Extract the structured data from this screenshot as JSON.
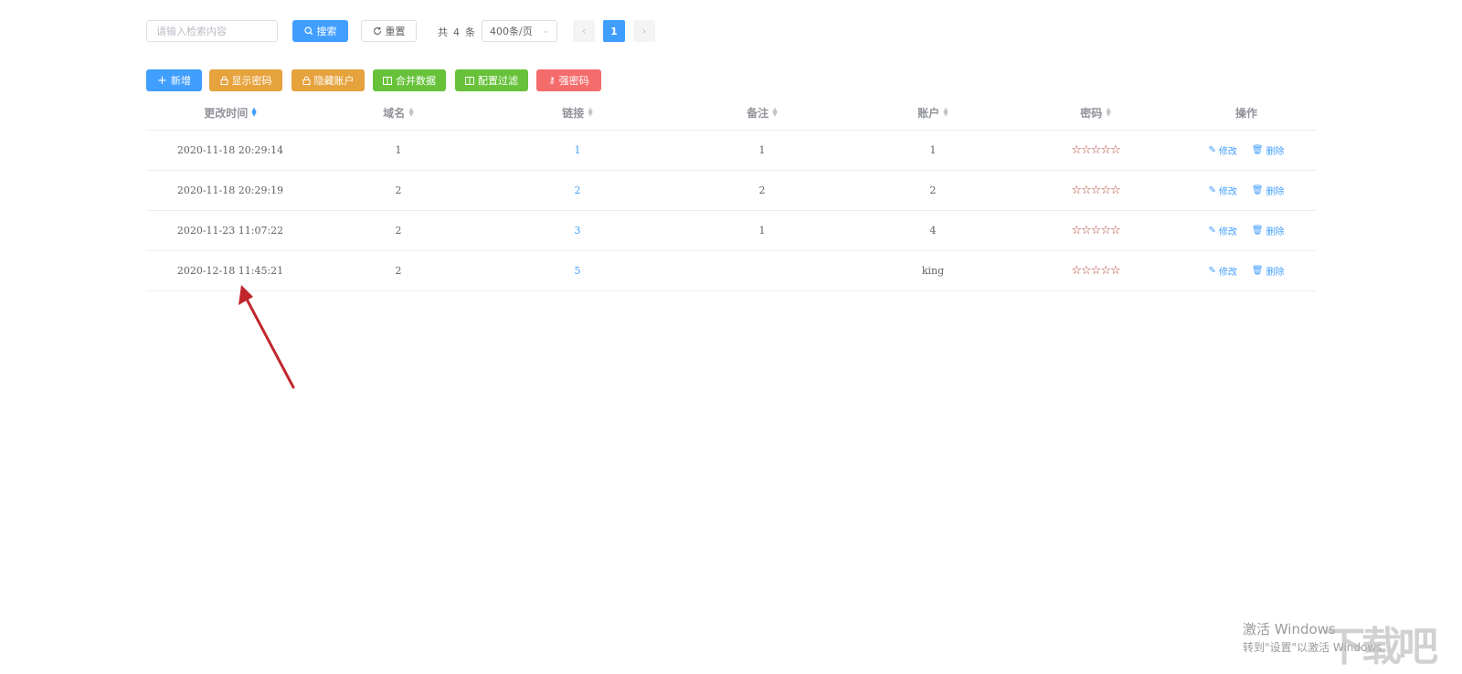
{
  "search": {
    "placeholder": "请输入检索内容",
    "search_label": "搜索",
    "reset_label": "重置"
  },
  "pagination": {
    "total_prefix": "共",
    "total_count": "4",
    "total_suffix": "条",
    "page_size": "400条/页",
    "current_page": "1"
  },
  "toolbar": {
    "add": "新增",
    "show_password": "显示密码",
    "hide_account": "隐藏账户",
    "merge_data": "合并数据",
    "config_filter": "配置过滤",
    "strong_password": "强密码"
  },
  "table": {
    "headers": [
      "更改时间",
      "域名",
      "链接",
      "备注",
      "账户",
      "密码",
      "操作"
    ],
    "rows": [
      {
        "time": "2020-11-18 20:29:14",
        "domain": "1",
        "link": "1",
        "note": "1",
        "account": "1",
        "password": "☆☆☆☆☆"
      },
      {
        "time": "2020-11-18 20:29:19",
        "domain": "2",
        "link": "2",
        "note": "2",
        "account": "2",
        "password": "☆☆☆☆☆"
      },
      {
        "time": "2020-11-23 11:07:22",
        "domain": "2",
        "link": "3",
        "note": "1",
        "account": "4",
        "password": "☆☆☆☆☆"
      },
      {
        "time": "2020-12-18 11:45:21",
        "domain": "2",
        "link": "5",
        "note": "",
        "account": "king",
        "password": "☆☆☆☆☆"
      }
    ],
    "edit_label": "修改",
    "delete_label": "删除"
  },
  "os_watermark": {
    "line1": "激活 Windows",
    "line2": "转到\"设置\"以激活 Windows。"
  },
  "site_watermark": "下载吧",
  "colors": {
    "primary": "#409eff",
    "warning": "#e6a23c",
    "success": "#67c23a",
    "danger": "#f56c6c",
    "arrow": "#c0272d"
  }
}
